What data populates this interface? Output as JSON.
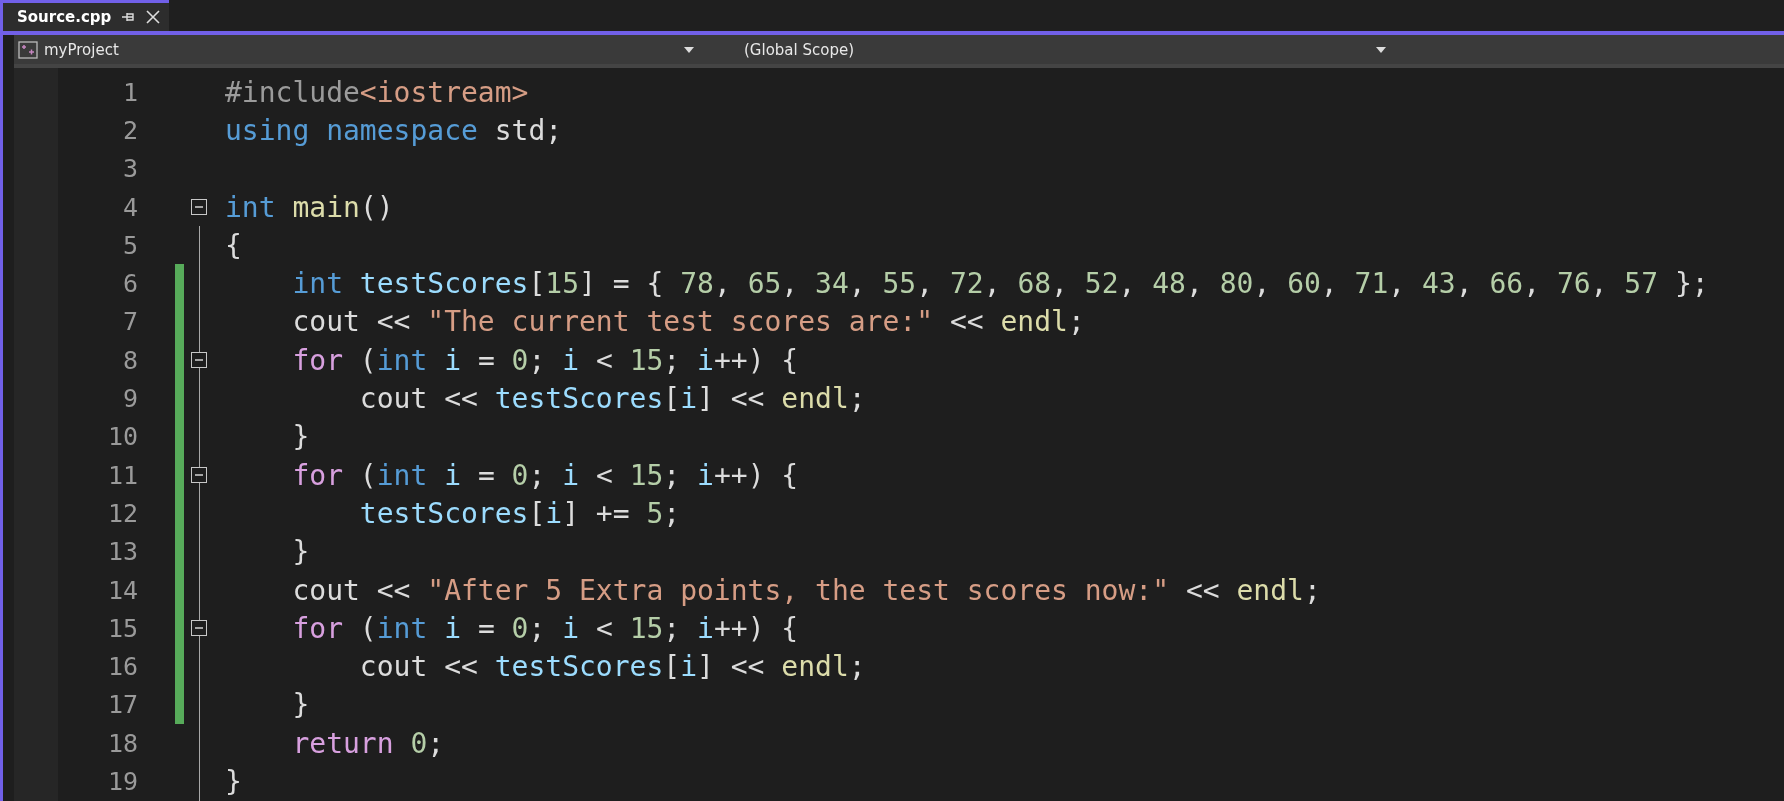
{
  "tab": {
    "title": "Source.cpp",
    "selected": true
  },
  "nav": {
    "project": "myProject",
    "scope": "(Global Scope)"
  },
  "lines": [
    {
      "number": "1",
      "changed": false,
      "foldable": false,
      "tokens": [
        {
          "kind": "preproc",
          "text": "#include"
        },
        {
          "kind": "string",
          "text": "<iostream>"
        }
      ]
    },
    {
      "number": "2",
      "changed": false,
      "foldable": false,
      "tokens": [
        {
          "kind": "keyword",
          "text": "using"
        },
        {
          "kind": "keyword",
          "text": " namespace"
        },
        {
          "kind": "plain",
          "text": " std;"
        }
      ]
    },
    {
      "number": "3",
      "changed": false,
      "foldable": false
    },
    {
      "number": "4",
      "changed": false,
      "foldable": true,
      "tokens": [
        {
          "kind": "keyword",
          "text": "int"
        },
        {
          "kind": "function",
          "text": " main"
        },
        {
          "kind": "plain",
          "text": "()"
        }
      ]
    },
    {
      "number": "5",
      "changed": false,
      "foldable": false,
      "tokens": [
        {
          "kind": "plain",
          "text": "{"
        }
      ]
    },
    {
      "number": "6",
      "changed": true,
      "foldable": false,
      "tokens": [
        {
          "kind": "keyword",
          "text": "    int"
        },
        {
          "kind": "variable",
          "text": " testScores"
        },
        {
          "kind": "plain",
          "text": "["
        },
        {
          "kind": "number",
          "text": "15"
        },
        {
          "kind": "plain",
          "text": "] = { "
        },
        {
          "kind": "number",
          "text": "78"
        },
        {
          "kind": "plain",
          "text": ", "
        },
        {
          "kind": "number",
          "text": "65"
        },
        {
          "kind": "plain",
          "text": ", "
        },
        {
          "kind": "number",
          "text": "34"
        },
        {
          "kind": "plain",
          "text": ", "
        },
        {
          "kind": "number",
          "text": "55"
        },
        {
          "kind": "plain",
          "text": ", "
        },
        {
          "kind": "number",
          "text": "72"
        },
        {
          "kind": "plain",
          "text": ", "
        },
        {
          "kind": "number",
          "text": "68"
        },
        {
          "kind": "plain",
          "text": ", "
        },
        {
          "kind": "number",
          "text": "52"
        },
        {
          "kind": "plain",
          "text": ", "
        },
        {
          "kind": "number",
          "text": "48"
        },
        {
          "kind": "plain",
          "text": ", "
        },
        {
          "kind": "number",
          "text": "80"
        },
        {
          "kind": "plain",
          "text": ", "
        },
        {
          "kind": "number",
          "text": "60"
        },
        {
          "kind": "plain",
          "text": ", "
        },
        {
          "kind": "number",
          "text": "71"
        },
        {
          "kind": "plain",
          "text": ", "
        },
        {
          "kind": "number",
          "text": "43"
        },
        {
          "kind": "plain",
          "text": ", "
        },
        {
          "kind": "number",
          "text": "66"
        },
        {
          "kind": "plain",
          "text": ", "
        },
        {
          "kind": "number",
          "text": "76"
        },
        {
          "kind": "plain",
          "text": ", "
        },
        {
          "kind": "number",
          "text": "57"
        },
        {
          "kind": "plain",
          "text": " };"
        }
      ]
    },
    {
      "number": "7",
      "changed": true,
      "foldable": false,
      "tokens": [
        {
          "kind": "plain",
          "text": "    cout << "
        },
        {
          "kind": "string",
          "text": "\"The current test scores are:\""
        },
        {
          "kind": "plain",
          "text": " << "
        },
        {
          "kind": "function",
          "text": "endl"
        },
        {
          "kind": "plain",
          "text": ";"
        }
      ]
    },
    {
      "number": "8",
      "changed": true,
      "foldable": true,
      "tokens": [
        {
          "kind": "control",
          "text": "    for"
        },
        {
          "kind": "plain",
          "text": " ("
        },
        {
          "kind": "keyword",
          "text": "int"
        },
        {
          "kind": "variable",
          "text": " i"
        },
        {
          "kind": "plain",
          "text": " = "
        },
        {
          "kind": "number",
          "text": "0"
        },
        {
          "kind": "plain",
          "text": "; "
        },
        {
          "kind": "variable",
          "text": "i"
        },
        {
          "kind": "plain",
          "text": " < "
        },
        {
          "kind": "number",
          "text": "15"
        },
        {
          "kind": "plain",
          "text": "; "
        },
        {
          "kind": "variable",
          "text": "i"
        },
        {
          "kind": "plain",
          "text": "++) {"
        }
      ]
    },
    {
      "number": "9",
      "changed": true,
      "foldable": false,
      "tokens": [
        {
          "kind": "plain",
          "text": "        cout << "
        },
        {
          "kind": "variable",
          "text": "testScores"
        },
        {
          "kind": "plain",
          "text": "["
        },
        {
          "kind": "variable",
          "text": "i"
        },
        {
          "kind": "plain",
          "text": "] << "
        },
        {
          "kind": "function",
          "text": "endl"
        },
        {
          "kind": "plain",
          "text": ";"
        }
      ]
    },
    {
      "number": "10",
      "changed": true,
      "foldable": false,
      "tokens": [
        {
          "kind": "plain",
          "text": "    }"
        }
      ]
    },
    {
      "number": "11",
      "changed": true,
      "foldable": true,
      "tokens": [
        {
          "kind": "control",
          "text": "    for"
        },
        {
          "kind": "plain",
          "text": " ("
        },
        {
          "kind": "keyword",
          "text": "int"
        },
        {
          "kind": "variable",
          "text": " i"
        },
        {
          "kind": "plain",
          "text": " = "
        },
        {
          "kind": "number",
          "text": "0"
        },
        {
          "kind": "plain",
          "text": "; "
        },
        {
          "kind": "variable",
          "text": "i"
        },
        {
          "kind": "plain",
          "text": " < "
        },
        {
          "kind": "number",
          "text": "15"
        },
        {
          "kind": "plain",
          "text": "; "
        },
        {
          "kind": "variable",
          "text": "i"
        },
        {
          "kind": "plain",
          "text": "++) {"
        }
      ]
    },
    {
      "number": "12",
      "changed": true,
      "foldable": false,
      "tokens": [
        {
          "kind": "variable",
          "text": "        testScores"
        },
        {
          "kind": "plain",
          "text": "["
        },
        {
          "kind": "variable",
          "text": "i"
        },
        {
          "kind": "plain",
          "text": "] += "
        },
        {
          "kind": "number",
          "text": "5"
        },
        {
          "kind": "plain",
          "text": ";"
        }
      ]
    },
    {
      "number": "13",
      "changed": true,
      "foldable": false,
      "tokens": [
        {
          "kind": "plain",
          "text": "    }"
        }
      ]
    },
    {
      "number": "14",
      "changed": true,
      "foldable": false,
      "tokens": [
        {
          "kind": "plain",
          "text": "    cout << "
        },
        {
          "kind": "string",
          "text": "\"After 5 Extra points, the test scores now:\""
        },
        {
          "kind": "plain",
          "text": " << "
        },
        {
          "kind": "function",
          "text": "endl"
        },
        {
          "kind": "plain",
          "text": ";"
        }
      ]
    },
    {
      "number": "15",
      "changed": true,
      "foldable": true,
      "tokens": [
        {
          "kind": "control",
          "text": "    for"
        },
        {
          "kind": "plain",
          "text": " ("
        },
        {
          "kind": "keyword",
          "text": "int"
        },
        {
          "kind": "variable",
          "text": " i"
        },
        {
          "kind": "plain",
          "text": " = "
        },
        {
          "kind": "number",
          "text": "0"
        },
        {
          "kind": "plain",
          "text": "; "
        },
        {
          "kind": "variable",
          "text": "i"
        },
        {
          "kind": "plain",
          "text": " < "
        },
        {
          "kind": "number",
          "text": "15"
        },
        {
          "kind": "plain",
          "text": "; "
        },
        {
          "kind": "variable",
          "text": "i"
        },
        {
          "kind": "plain",
          "text": "++) {"
        }
      ]
    },
    {
      "number": "16",
      "changed": true,
      "foldable": false,
      "tokens": [
        {
          "kind": "plain",
          "text": "        cout << "
        },
        {
          "kind": "variable",
          "text": "testScores"
        },
        {
          "kind": "plain",
          "text": "["
        },
        {
          "kind": "variable",
          "text": "i"
        },
        {
          "kind": "plain",
          "text": "] << "
        },
        {
          "kind": "function",
          "text": "endl"
        },
        {
          "kind": "plain",
          "text": ";"
        }
      ]
    },
    {
      "number": "17",
      "changed": true,
      "foldable": false,
      "tokens": [
        {
          "kind": "plain",
          "text": "    }"
        }
      ]
    },
    {
      "number": "18",
      "changed": false,
      "foldable": false,
      "tokens": [
        {
          "kind": "control",
          "text": "    return"
        },
        {
          "kind": "number",
          "text": " 0"
        },
        {
          "kind": "plain",
          "text": ";"
        }
      ]
    },
    {
      "number": "19",
      "changed": false,
      "foldable": false,
      "tokens": [
        {
          "kind": "plain",
          "text": "}"
        }
      ]
    }
  ]
}
